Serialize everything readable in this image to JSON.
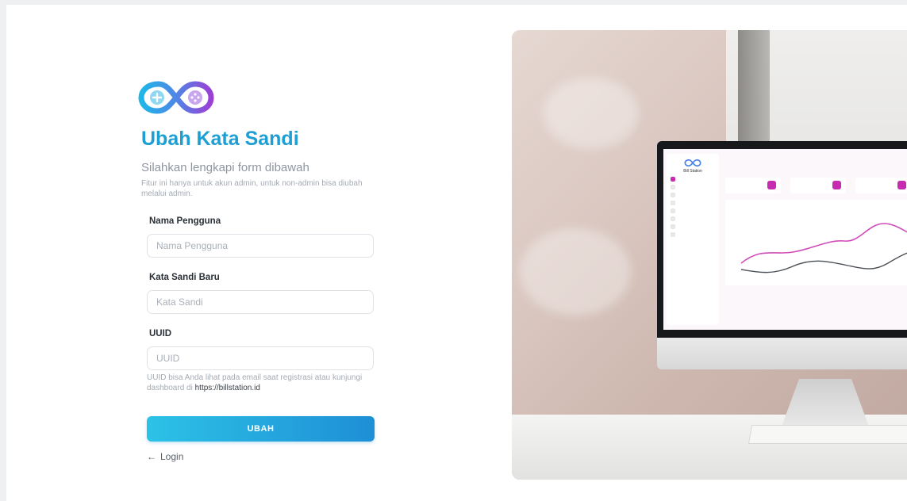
{
  "brand": {
    "name": "Bill Station"
  },
  "form": {
    "title": "Ubah Kata Sandi",
    "subtitle": "Silahkan lengkapi form dibawah",
    "note": "Fitur ini hanya untuk akun admin, untuk non-admin bisa diubah melalui admin.",
    "username": {
      "label": "Nama Pengguna",
      "placeholder": "Nama Pengguna",
      "value": ""
    },
    "password": {
      "label": "Kata Sandi Baru",
      "placeholder": "Kata Sandi",
      "value": ""
    },
    "uuid": {
      "label": "UUID",
      "placeholder": "UUID",
      "value": "",
      "hint_text": "UUID bisa Anda lihat pada email saat registrasi atau kunjungi dashboard di",
      "hint_link": "https://billstation.id"
    },
    "submit_label": "UBAH",
    "back_label": "Login",
    "back_icon": "arrow-left-icon"
  },
  "colors": {
    "title": "#1d9fd3",
    "button_start": "#2cc2e6",
    "button_end": "#1e8fd6",
    "logo_blue": "#1fb6e8",
    "logo_purple": "#9b3fd6",
    "dashboard_accent": "#c72bb0"
  }
}
